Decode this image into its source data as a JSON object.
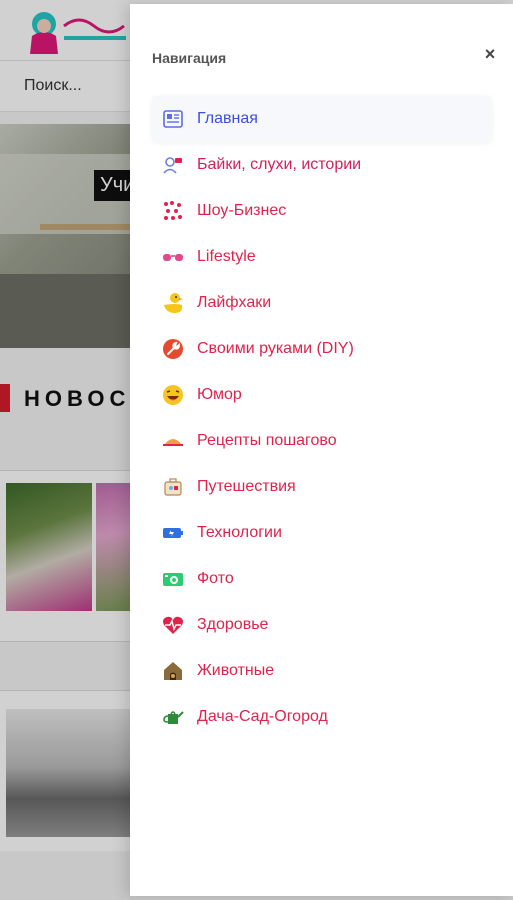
{
  "background": {
    "search_placeholder": "Поиск...",
    "hero_title_fragment": "Учи",
    "news_heading_fragment": "НОВОС"
  },
  "drawer": {
    "title": "Навигация",
    "close_label": "×",
    "items": [
      {
        "label": "Главная",
        "icon": "newspaper-icon",
        "active": true
      },
      {
        "label": "Байки, слухи, истории",
        "icon": "users-chat-icon",
        "active": false
      },
      {
        "label": "Шоу-Бизнес",
        "icon": "music-notes-icon",
        "active": false
      },
      {
        "label": "Lifestyle",
        "icon": "glasses-icon",
        "active": false
      },
      {
        "label": "Лайфхаки",
        "icon": "duck-icon",
        "active": false
      },
      {
        "label": "Своими руками (DIY)",
        "icon": "wrench-icon",
        "active": false
      },
      {
        "label": "Юмор",
        "icon": "laughing-face-icon",
        "active": false
      },
      {
        "label": "Рецепты пошагово",
        "icon": "food-dish-icon",
        "active": false
      },
      {
        "label": "Путешествия",
        "icon": "suitcase-icon",
        "active": false
      },
      {
        "label": "Технологии",
        "icon": "battery-icon",
        "active": false
      },
      {
        "label": "Фото",
        "icon": "camera-icon",
        "active": false
      },
      {
        "label": "Здоровье",
        "icon": "heartbeat-icon",
        "active": false
      },
      {
        "label": "Животные",
        "icon": "dog-house-icon",
        "active": false
      },
      {
        "label": "Дача-Сад-Огород",
        "icon": "watering-can-icon",
        "active": false
      }
    ]
  },
  "colors": {
    "active_link": "#3b4fe0",
    "link": "#e0234b",
    "accent_red": "#d81b2d"
  }
}
